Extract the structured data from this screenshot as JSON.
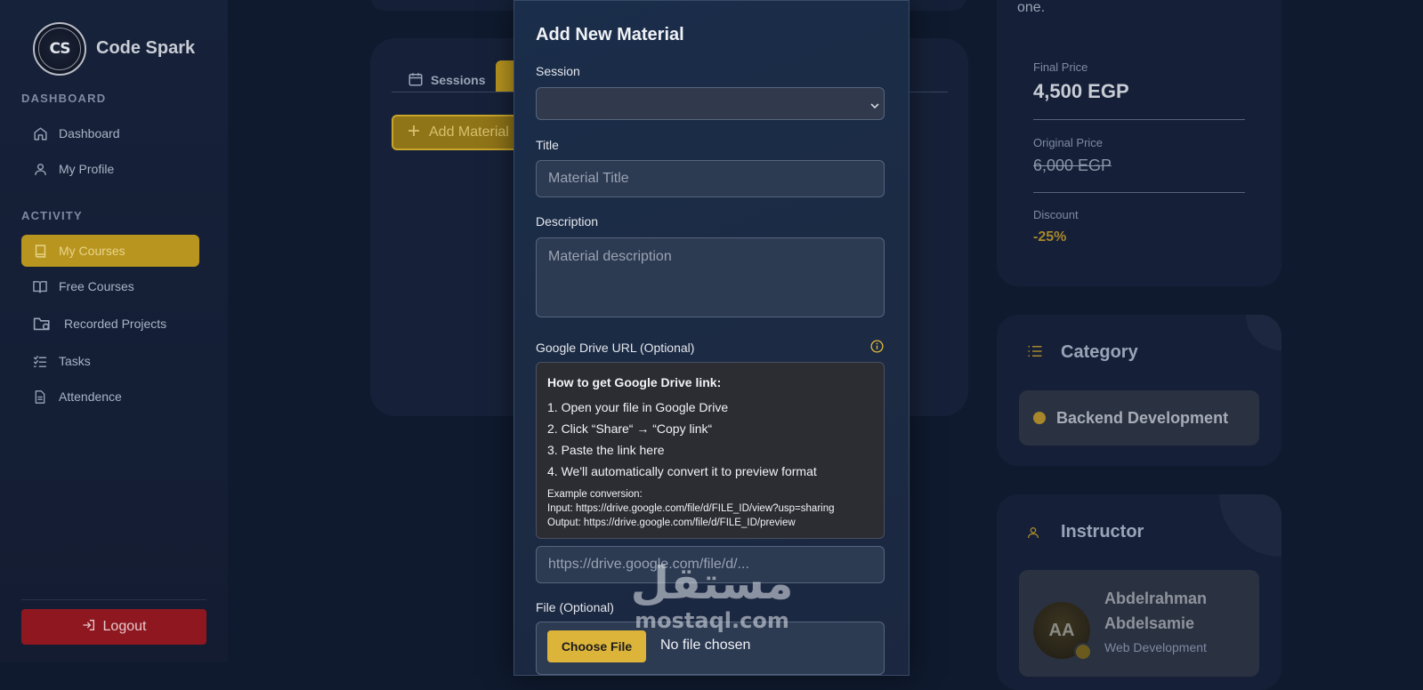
{
  "brand": {
    "name": "Code Spark",
    "logo_text": "CS"
  },
  "sidebar": {
    "sections": [
      {
        "label": "DASHBOARD",
        "items": [
          {
            "label": "Dashboard",
            "icon": "home-icon"
          },
          {
            "label": "My Profile",
            "icon": "user-icon"
          }
        ]
      },
      {
        "label": "ACTIVITY",
        "items": [
          {
            "label": "My Courses",
            "icon": "book-icon",
            "active": true
          },
          {
            "label": "Free Courses",
            "icon": "open-book-icon"
          },
          {
            "label": "Recorded Projects",
            "icon": "folder-icon"
          },
          {
            "label": "Tasks",
            "icon": "checklist-icon"
          },
          {
            "label": "Attendence",
            "icon": "document-icon"
          }
        ]
      }
    ],
    "logout_label": "Logout"
  },
  "main": {
    "tabs": [
      {
        "label": "Sessions",
        "icon": "calendar-icon"
      }
    ],
    "add_material_label": "Add Material"
  },
  "right_panel": {
    "top_text": "one.",
    "pricing": {
      "final_label": "Final Price",
      "final_value": "4,500 EGP",
      "original_label": "Original Price",
      "original_value": "6,000 EGP",
      "discount_label": "Discount",
      "discount_value": "-25%"
    },
    "category": {
      "title": "Category",
      "value": "Backend Development"
    },
    "instructor": {
      "title": "Instructor",
      "initials": "AA",
      "name": "Abdelrahman Abdelsamie",
      "role": "Web Development"
    }
  },
  "modal": {
    "title": "Add New Material",
    "session_label": "Session",
    "session_value": "",
    "title_label": "Title",
    "title_placeholder": "Material Title",
    "description_label": "Description",
    "description_placeholder": "Material description",
    "drive_label": "Google Drive URL (Optional)",
    "help": {
      "title": "How to get Google Drive link:",
      "steps": [
        "1. Open your file in Google Drive",
        "2. Click “Share“ → “Copy link“",
        "3. Paste the link here",
        "4. We'll automatically convert it to preview format"
      ],
      "example_heading": "Example conversion:",
      "example_input": "Input: https://drive.google.com/file/d/FILE_ID/view?usp=sharing",
      "example_output": "Output: https://drive.google.com/file/d/FILE_ID/preview"
    },
    "drive_placeholder": "https://drive.google.com/file/d/...",
    "file_label": "File (Optional)",
    "choose_file_label": "Choose File",
    "no_file_text": "No file chosen"
  },
  "watermark": {
    "arabic": "مستقل",
    "latin": "mostaql.com"
  },
  "colors": {
    "accent_gold": "#b8951f",
    "logout_red": "#8f1720",
    "modal_bg": "#1a2d4a",
    "page_bg": "#0f1a2e"
  }
}
